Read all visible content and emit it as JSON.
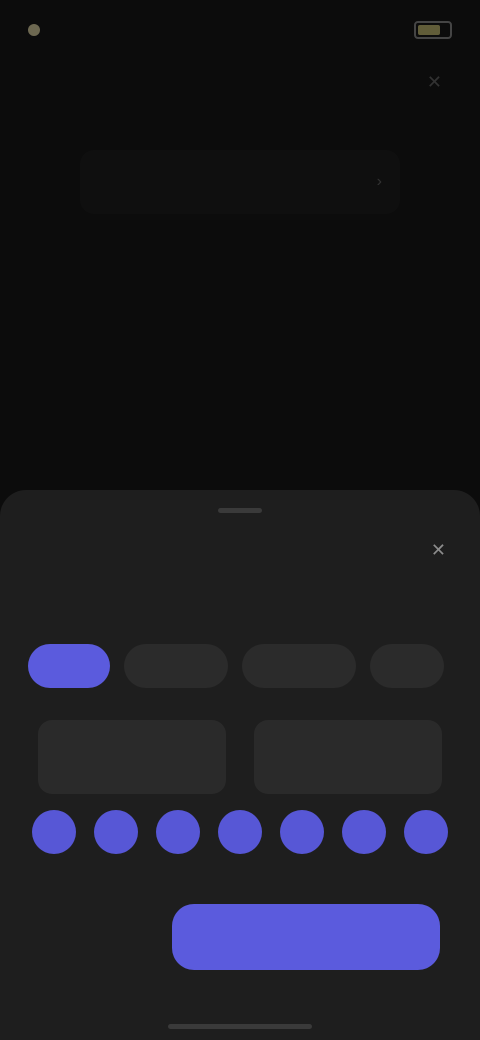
{
  "status_bar": {
    "time": "",
    "icon_left": "dot-icon",
    "battery": "battery-icon"
  },
  "background": {
    "title": "",
    "banner": {
      "label": ""
    },
    "rows": [
      {
        "label": "",
        "value": ""
      },
      {
        "label": "",
        "value": ""
      }
    ],
    "hint": ""
  },
  "sheet": {
    "title": "",
    "subtitle": "",
    "chips": [
      {
        "label": ""
      },
      {
        "label": ""
      },
      {
        "label": ""
      },
      {
        "label": ""
      }
    ],
    "start_time": "",
    "end_time": "",
    "days": [
      "",
      "",
      "",
      "",
      "",
      "",
      ""
    ],
    "delete_label": "",
    "save_label": ""
  },
  "colors": {
    "accent": "#5b5bdd",
    "sheet_bg": "#1e1e1e",
    "page_bg": "#0c0c0c",
    "danger": "#9a5a3e"
  }
}
